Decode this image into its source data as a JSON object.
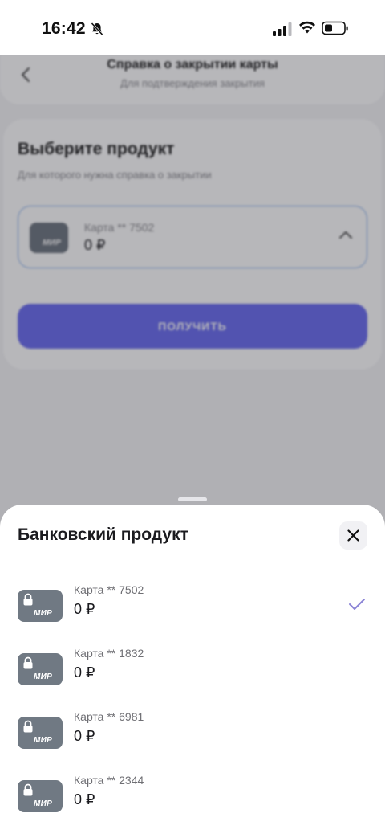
{
  "status_bar": {
    "time": "16:42"
  },
  "background": {
    "header_title": "Справка о закрытии карты",
    "header_subtitle": "Для подтверждения закрытия",
    "choose_title": "Выберите продукт",
    "choose_subtitle": "Для которого нужна справка о закрытии",
    "selected": {
      "name": "Карта ** 7502",
      "balance": "0 ₽",
      "card_logo": "МИР"
    },
    "get_button": "Получить"
  },
  "sheet": {
    "title": "Банковский продукт",
    "items": [
      {
        "name": "Карта ** 7502",
        "balance": "0 ₽",
        "logo": "МИР",
        "selected": true
      },
      {
        "name": "Карта ** 1832",
        "balance": "0 ₽",
        "logo": "МИР",
        "selected": false
      },
      {
        "name": "Карта ** 6981",
        "balance": "0 ₽",
        "logo": "МИР",
        "selected": false
      },
      {
        "name": "Карта ** 2344",
        "balance": "0 ₽",
        "logo": "МИР",
        "selected": false
      }
    ]
  },
  "colors": {
    "accent": "#6a6cf0",
    "check": "#8b84d6",
    "card": "#707983"
  }
}
